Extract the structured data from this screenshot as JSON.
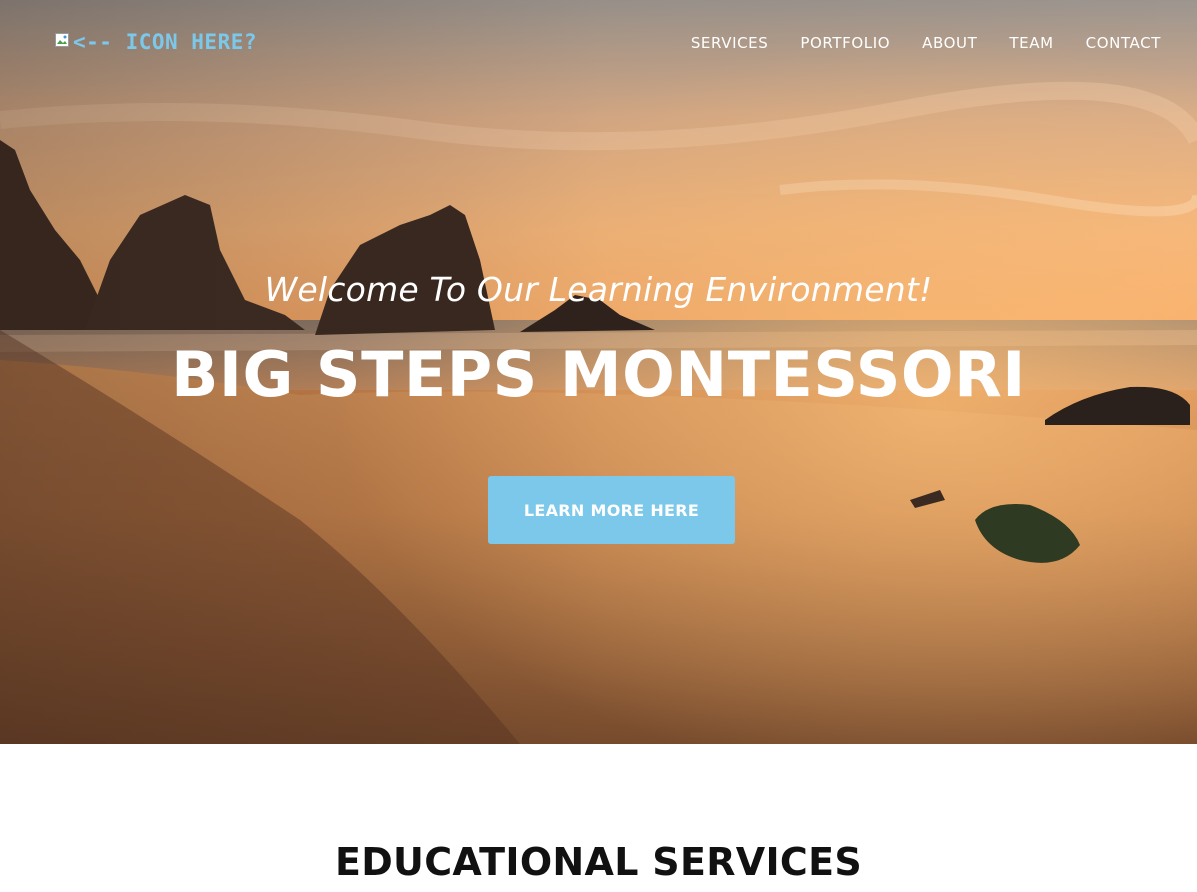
{
  "nav": {
    "logo_text": "<-- ICON HERE?",
    "links": [
      {
        "label": "SERVICES"
      },
      {
        "label": "PORTFOLIO"
      },
      {
        "label": "ABOUT"
      },
      {
        "label": "TEAM"
      },
      {
        "label": "CONTACT"
      }
    ]
  },
  "hero": {
    "subheading": "Welcome To Our Learning Environment!",
    "heading": "BIG STEPS MONTESSORI",
    "cta_label": "LEARN MORE HERE"
  },
  "services": {
    "title": "EDUCATIONAL SERVICES"
  },
  "colors": {
    "accent": "#7cc8ea",
    "heading_text": "#111111",
    "hero_text": "#ffffff"
  }
}
